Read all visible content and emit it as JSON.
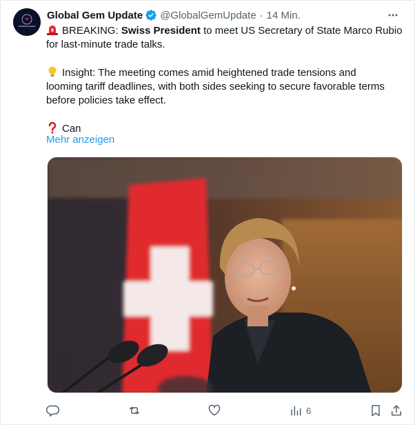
{
  "author": {
    "display_name": "Global Gem Update",
    "handle": "@GlobalGemUpdate",
    "separator": "·",
    "time": "14 Min.",
    "avatar_text": "GlobalGemUpdate"
  },
  "tweet": {
    "line1_prefix": "BREAKING: ",
    "line1_bold": "Swiss President",
    "line1_suffix": " to meet US Secretary of State Marco Rubio",
    "line2": "for last-minute trade talks.",
    "insight_line1": "Insight: The meeting comes amid heightened trade tensions and",
    "insight_line2": "looming tariff deadlines, with both sides seeking to secure favorable terms",
    "insight_line3": "before policies take effect.",
    "question_line": "Can",
    "show_more": "Mehr anzeigen"
  },
  "actions": {
    "views_count": "6"
  },
  "icons": {
    "more": "more-horizontal-icon",
    "verified": "verified-badge-icon",
    "siren": "rotating-light-icon",
    "bulb": "light-bulb-icon",
    "question": "question-mark-icon",
    "reply": "reply-icon",
    "retweet": "retweet-icon",
    "like": "like-icon",
    "views": "views-icon",
    "bookmark": "bookmark-icon",
    "share": "share-icon"
  },
  "colors": {
    "link": "#1d9bf0",
    "verified": "#1d9bf0",
    "secondary_text": "#536471",
    "primary_text": "#0f1419"
  }
}
